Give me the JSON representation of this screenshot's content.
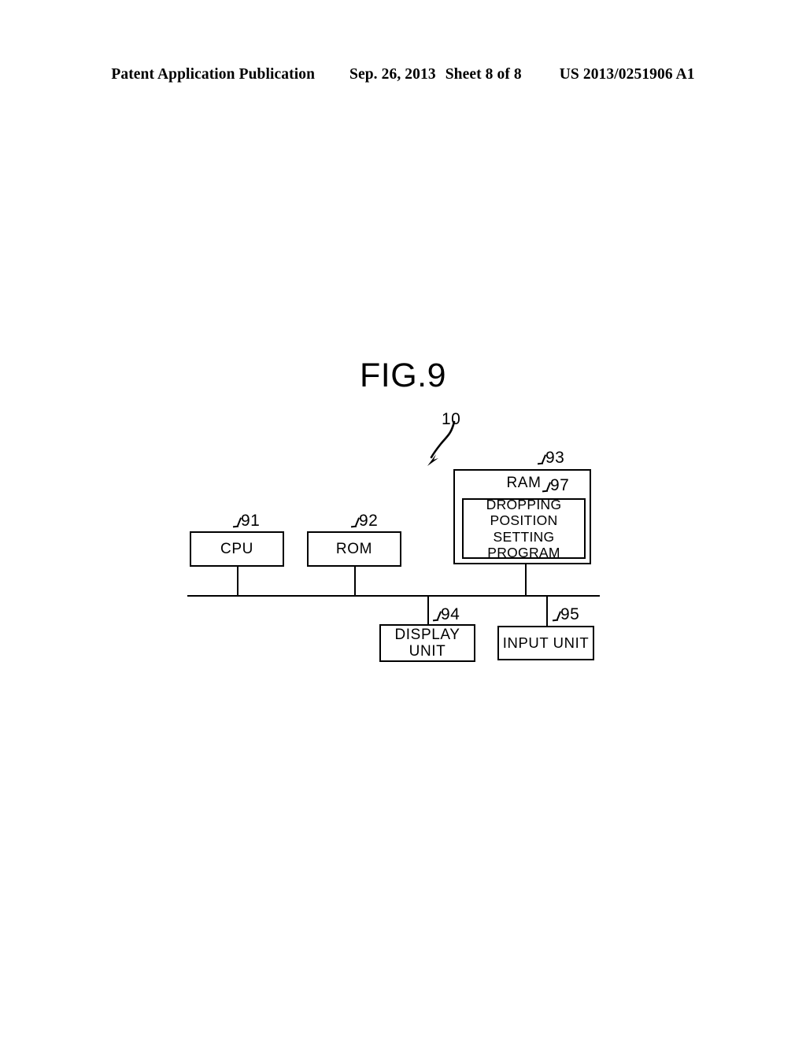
{
  "header": {
    "publication": "Patent Application Publication",
    "date": "Sep. 26, 2013",
    "sheet": "Sheet 8 of 8",
    "patent_number": "US 2013/0251906 A1"
  },
  "figure": {
    "title": "FIG.9",
    "system_ref": "10",
    "blocks": [
      {
        "id": "cpu",
        "label": "CPU",
        "ref": "91"
      },
      {
        "id": "rom",
        "label": "ROM",
        "ref": "92"
      },
      {
        "id": "ram",
        "label": "RAM",
        "ref": "93"
      },
      {
        "id": "program",
        "label": "DROPPING POSITION SETTING PROGRAM",
        "ref": "97"
      },
      {
        "id": "display",
        "label": "DISPLAY UNIT",
        "ref": "94"
      },
      {
        "id": "input",
        "label": "INPUT UNIT",
        "ref": "95"
      }
    ]
  },
  "colors": {
    "ink": "#000000",
    "paper": "#ffffff"
  }
}
